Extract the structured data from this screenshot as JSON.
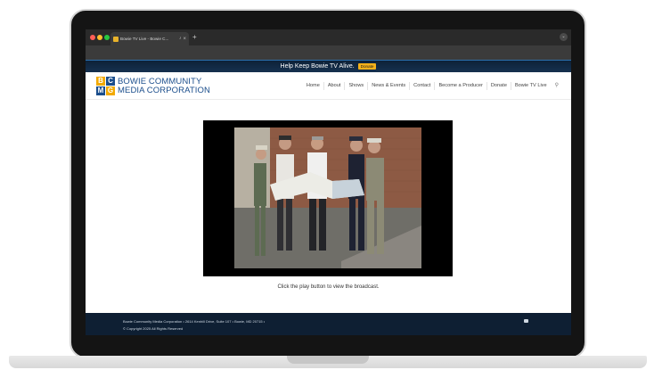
{
  "browser": {
    "tab_title": "Bowie TV Live - Bowie C...",
    "tab_audio_icon": "speaker-icon",
    "tab_close": "×",
    "new_tab": "+",
    "menu_icon": "⌄"
  },
  "banner": {
    "text": "Help Keep Bowie TV Alive.",
    "donate_label": "Donate",
    "accent_color": "#f4b11a"
  },
  "logo": {
    "letters": [
      "B",
      "C",
      "M",
      "G"
    ],
    "line1": "BOWIE COMMUNITY",
    "line2": "MEDIA CORPORATION",
    "brand_color": "#1b4e8c"
  },
  "nav": {
    "items": [
      "Home",
      "About",
      "Shows",
      "News & Events",
      "Contact",
      "Become a Producer",
      "Donate",
      "Bowie TV Live"
    ],
    "search_icon": "search-icon"
  },
  "main": {
    "caption": "Click the play button to view the broadcast."
  },
  "footer": {
    "address": "Bowie Community Media Corporation • 2614 Kenhill Drive, Suite 107 • Bowie, MD 20715 •",
    "copyright": "© Copyright 2025 All Rights Reserved",
    "icon": "mail-icon"
  }
}
